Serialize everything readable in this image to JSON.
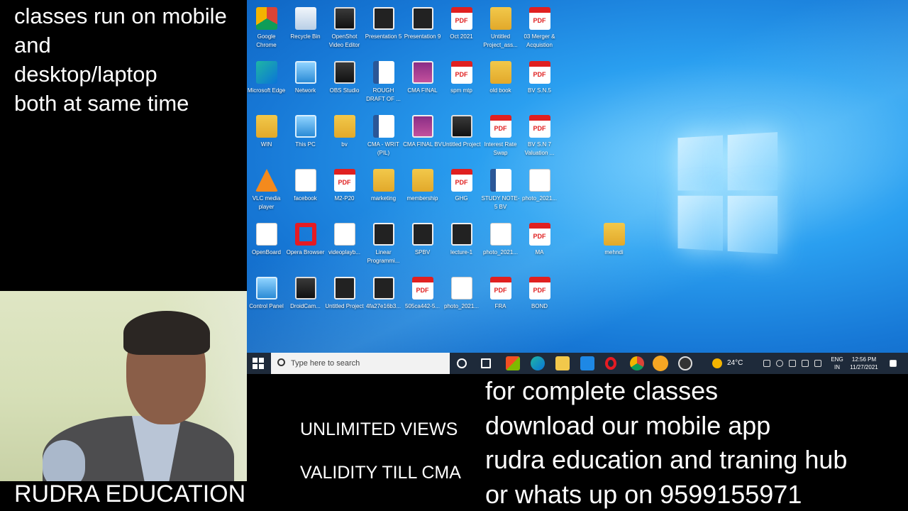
{
  "overlay": {
    "top_text": "classes run on mobile\nand\ndesktop/laptop\nboth at same time",
    "brand": "RUDRA EDUCATION",
    "unlimited": "UNLIMITED VIEWS",
    "validity": "VALIDITY TILL CMA",
    "promo": [
      "for complete classes",
      "download our mobile app",
      "rudra education and traning hub",
      "or whats up on 9599155971"
    ]
  },
  "desktop": {
    "icons": [
      {
        "label": "Google Chrome",
        "icon": "chrome-icon"
      },
      {
        "label": "Recycle Bin",
        "icon": "recycle-bin-icon"
      },
      {
        "label": "OpenShot Video Editor",
        "icon": "openshot-icon"
      },
      {
        "label": "Presentation 5",
        "icon": "video-thumb-icon"
      },
      {
        "label": "Presentation 9",
        "icon": "video-thumb-icon"
      },
      {
        "label": "Oct 2021",
        "icon": "pdf-icon"
      },
      {
        "label": "Untitled Project_ass...",
        "icon": "folder-icon"
      },
      {
        "label": "03 Merger & Acquistion",
        "icon": "pdf-icon"
      },
      {
        "label": "Microsoft Edge",
        "icon": "edge-icon"
      },
      {
        "label": "Network",
        "icon": "network-icon"
      },
      {
        "label": "OBS Studio",
        "icon": "obs-icon"
      },
      {
        "label": "ROUGH DRAFT OF ...",
        "icon": "word-doc-icon"
      },
      {
        "label": "CMA FINAL",
        "icon": "purple-thumb-icon"
      },
      {
        "label": "spm mtp",
        "icon": "pdf-icon"
      },
      {
        "label": "old book",
        "icon": "winrar-icon"
      },
      {
        "label": "BV S.N.5",
        "icon": "pdf-icon"
      },
      {
        "label": "WIN",
        "icon": "user-folder-icon"
      },
      {
        "label": "This PC",
        "icon": "this-pc-icon"
      },
      {
        "label": "bv",
        "icon": "archive-icon"
      },
      {
        "label": "CMA - WRIT (PIL)",
        "icon": "word-doc-icon"
      },
      {
        "label": "CMA FINAL BV",
        "icon": "purple-thumb-icon"
      },
      {
        "label": "Untitled Project",
        "icon": "openshot-icon"
      },
      {
        "label": "Interest Rate Swap",
        "icon": "pdf-icon"
      },
      {
        "label": "BV S.N 7 Valuation ...",
        "icon": "pdf-icon"
      },
      {
        "label": "VLC media player",
        "icon": "vlc-icon"
      },
      {
        "label": "facebook",
        "icon": "file-icon"
      },
      {
        "label": "M2-P20",
        "icon": "pdf-icon"
      },
      {
        "label": "marketing",
        "icon": "archive-icon"
      },
      {
        "label": "membership",
        "icon": "archive-icon"
      },
      {
        "label": "GHG",
        "icon": "pdf-icon"
      },
      {
        "label": "STUDY NOTE-5 BV",
        "icon": "word-doc-icon"
      },
      {
        "label": "photo_2021...",
        "icon": "photo-icon"
      },
      {
        "label": "OpenBoard",
        "icon": "openboard-icon"
      },
      {
        "label": "Opera Browser",
        "icon": "opera-icon"
      },
      {
        "label": "videoplayb...",
        "icon": "photo-icon"
      },
      {
        "label": "Linear Programmi...",
        "icon": "video-thumb-icon"
      },
      {
        "label": "SPBV",
        "icon": "video-thumb-icon"
      },
      {
        "label": "lecture-1",
        "icon": "video-thumb-icon"
      },
      {
        "label": "photo_2021...",
        "icon": "photo-icon"
      },
      {
        "label": "MA",
        "icon": "pdf-icon"
      },
      {
        "label": "mehndi",
        "icon": "winrar-icon"
      },
      {
        "label": "Control Panel",
        "icon": "control-panel-icon"
      },
      {
        "label": "DroidCam...",
        "icon": "droidcam-icon"
      },
      {
        "label": "Untitled Project",
        "icon": "video-thumb-icon"
      },
      {
        "label": "4fa27e16b3...",
        "icon": "phone-image-icon"
      },
      {
        "label": "505ca442-5...",
        "icon": "pdf-icon"
      },
      {
        "label": "photo_2021...",
        "icon": "photo-icon"
      },
      {
        "label": "FRA",
        "icon": "pdf-icon"
      },
      {
        "label": "BOND",
        "icon": "pdf-icon"
      }
    ]
  },
  "taskbar": {
    "search_placeholder": "Type here to search",
    "weather": "24°C",
    "lang_top": "ENG",
    "lang_bottom": "IN",
    "time": "12:56 PM",
    "date": "11/27/2021"
  }
}
